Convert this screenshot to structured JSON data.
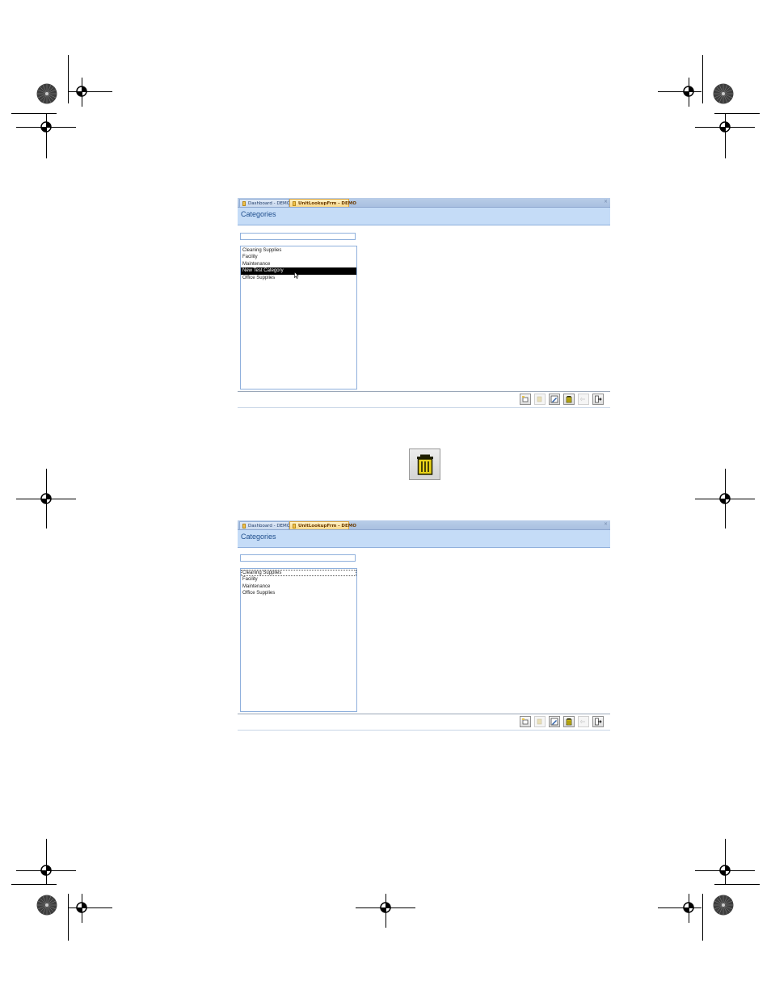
{
  "windows": [
    {
      "tabs": [
        {
          "label": "Dashboard - DEMO",
          "active": false
        },
        {
          "label": "UnitLookupFrm - DEMO",
          "active": true
        }
      ],
      "close_glyph": "×",
      "form_title": "Categories",
      "search_value": "",
      "list_items": [
        {
          "label": "Cleaning Supplies",
          "selected": false
        },
        {
          "label": "Facility",
          "selected": false
        },
        {
          "label": "Maintenance",
          "selected": false
        },
        {
          "label": "New Test Category",
          "selected": true
        },
        {
          "label": "Office Supplies",
          "selected": false
        }
      ],
      "toolbar": [
        {
          "name": "new-record-icon",
          "enabled": true
        },
        {
          "name": "save-record-icon",
          "enabled": false
        },
        {
          "name": "edit-record-icon",
          "enabled": true
        },
        {
          "name": "delete-record-icon",
          "enabled": true
        },
        {
          "name": "undo-icon",
          "enabled": false
        },
        {
          "name": "close-form-icon",
          "enabled": true
        }
      ]
    },
    {
      "tabs": [
        {
          "label": "Dashboard - DEMO",
          "active": false
        },
        {
          "label": "UnitLookupFrm - DEMO",
          "active": true
        }
      ],
      "close_glyph": "×",
      "form_title": "Categories",
      "search_value": "",
      "list_items": [
        {
          "label": "Cleaning Supplies",
          "selected": false,
          "focused": true
        },
        {
          "label": "Facility",
          "selected": false
        },
        {
          "label": "Maintenance",
          "selected": false
        },
        {
          "label": "Office Supplies",
          "selected": false
        }
      ],
      "toolbar": [
        {
          "name": "new-record-icon",
          "enabled": true
        },
        {
          "name": "save-record-icon",
          "enabled": false
        },
        {
          "name": "edit-record-icon",
          "enabled": true
        },
        {
          "name": "delete-record-icon",
          "enabled": true
        },
        {
          "name": "undo-icon",
          "enabled": false
        },
        {
          "name": "close-form-icon",
          "enabled": true
        }
      ]
    }
  ],
  "callout_icon": "trash-can-icon",
  "colors": {
    "header_bg": "#c5dcf7",
    "title_text": "#1f4e8c",
    "active_tab": "#f9d98a",
    "trash_yellow": "#e8d21a"
  }
}
